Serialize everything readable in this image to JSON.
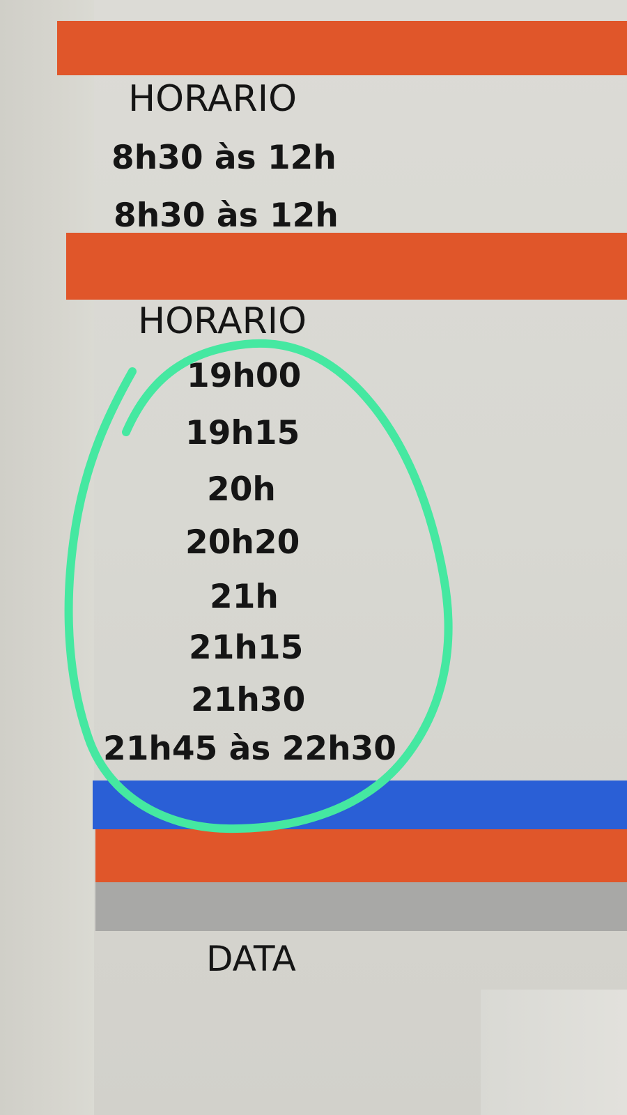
{
  "section_1": {
    "header": "HORARIO",
    "times": [
      "8h30 às 12h",
      "8h30 às 12h"
    ]
  },
  "section_2": {
    "header": "HORARIO",
    "times": [
      "19h00",
      "19h15",
      "20h",
      "20h20",
      "21h",
      "21h15",
      "21h30",
      "21h45 às 22h30"
    ]
  },
  "section_3": {
    "header": "DATA"
  },
  "colors": {
    "orange_band": "#e0562a",
    "blue_band": "#2a5fd6",
    "gray_band": "#a8a8a6",
    "highlight_circle": "#45e8a1"
  }
}
